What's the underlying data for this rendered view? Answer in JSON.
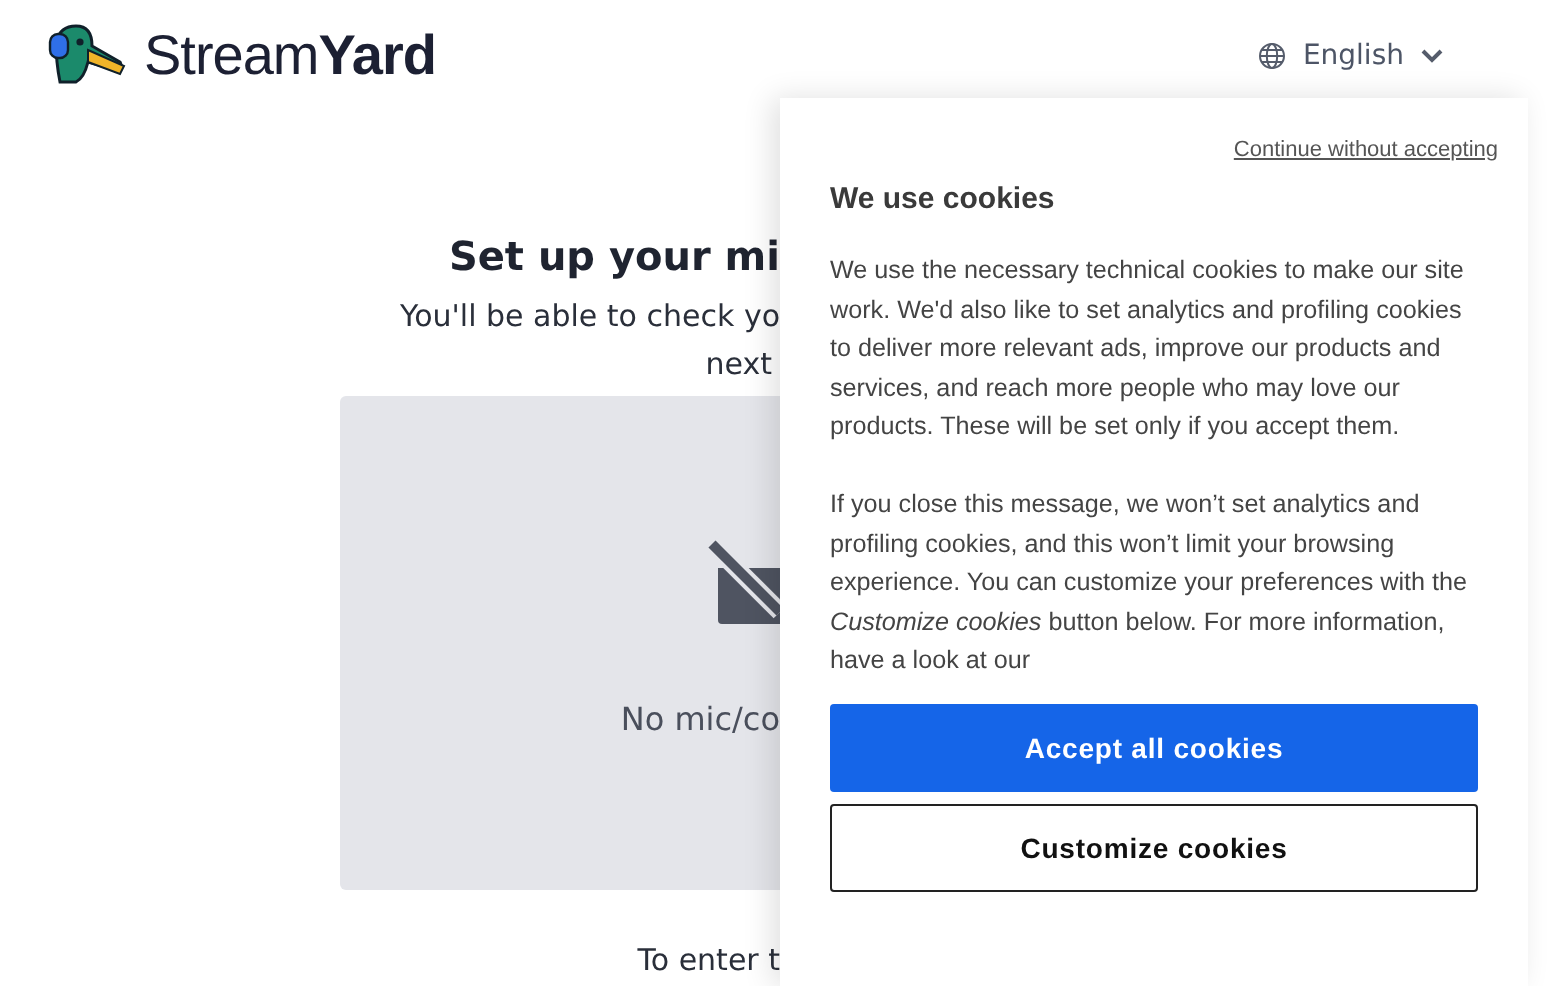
{
  "header": {
    "logo_text": "Stream**Yard**",
    "language": "English"
  },
  "setup": {
    "title": "Set up your mi",
    "subtitle": "You'll be able to check yo",
    "subtitle_line2": "next",
    "preview_message": "No mic/co",
    "footer_text": "To enter t"
  },
  "cookie_banner": {
    "skip_link": "Continue without accepting",
    "title": "We use cookies",
    "paragraphs": [
      "We use the necessary technical cookies to make our site work. We'd also like to set analytics and profiling cookies to deliver more relevant ads, improve our products and services, and reach more people who may love our products. These will be set only if you accept them.",
      "If you close this message, we won’t set analytics and profiling cookies, and this won’t limit your browsing experience. You can customize your preferences with the *Customize cookies* button below. For more information, have a look at our"
    ],
    "buttons": [
      {
        "label": "Accept all cookies",
        "kind": "primary"
      },
      {
        "label": "Customize cookies",
        "kind": "secondary"
      }
    ]
  }
}
